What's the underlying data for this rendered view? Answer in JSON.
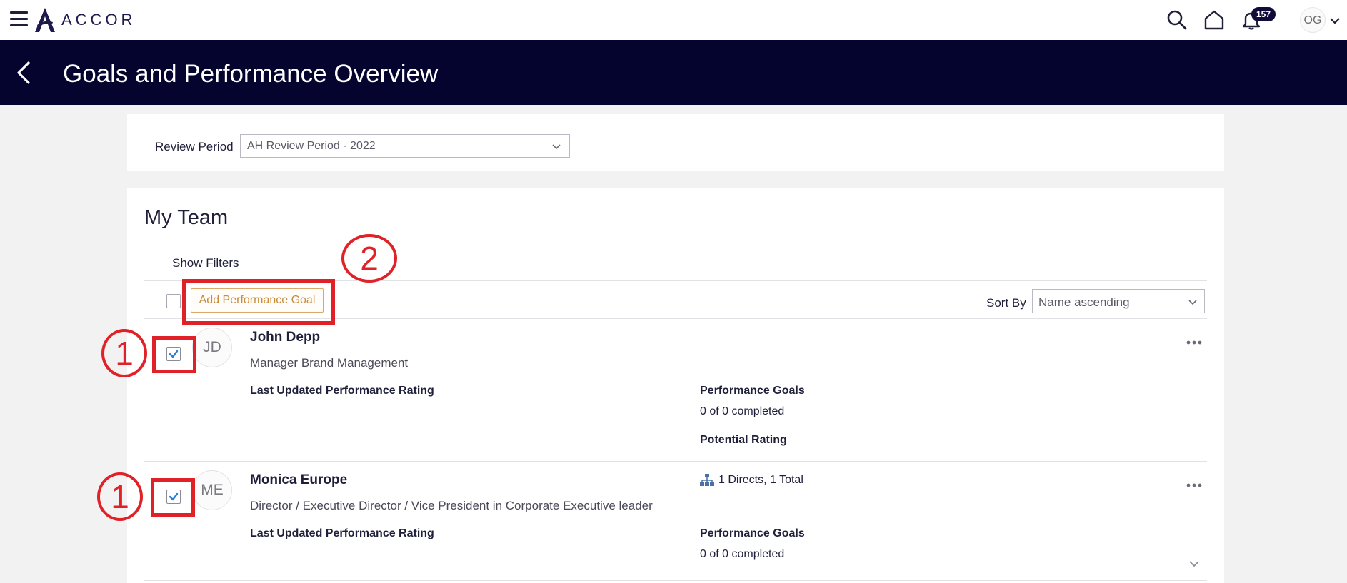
{
  "topbar": {
    "brand": "ACCOR",
    "notification_count": "157",
    "user_initials": "OG"
  },
  "header": {
    "title": "Goals and Performance Overview"
  },
  "review_period": {
    "label": "Review Period",
    "selected": "AH Review Period - 2022"
  },
  "team": {
    "title": "My Team",
    "show_filters": "Show Filters",
    "add_goal_label": "Add Performance Goal",
    "sort_label": "Sort By",
    "sort_selected": "Name ascending",
    "members": [
      {
        "initials": "JD",
        "name": "John Depp",
        "role": "Manager Brand Management",
        "checked": true,
        "rating_label": "Last Updated Performance Rating",
        "goals_label": "Performance Goals",
        "goals_value": "0 of 0 completed",
        "potential_label": "Potential Rating"
      },
      {
        "initials": "ME",
        "name": "Monica Europe",
        "role": "Director / Executive Director / Vice President in Corporate Executive leader",
        "checked": true,
        "directs": "1 Directs, 1 Total",
        "rating_label": "Last Updated Performance Rating",
        "goals_label": "Performance Goals",
        "goals_value": "0 of 0 completed"
      }
    ]
  },
  "annotations": {
    "step_one": "1",
    "step_two": "2"
  },
  "colors": {
    "header_bg": "#05042e",
    "accent_button": "#c98a3a",
    "annotation_red": "#e02127",
    "checkbox_check": "#2a7fd4"
  }
}
